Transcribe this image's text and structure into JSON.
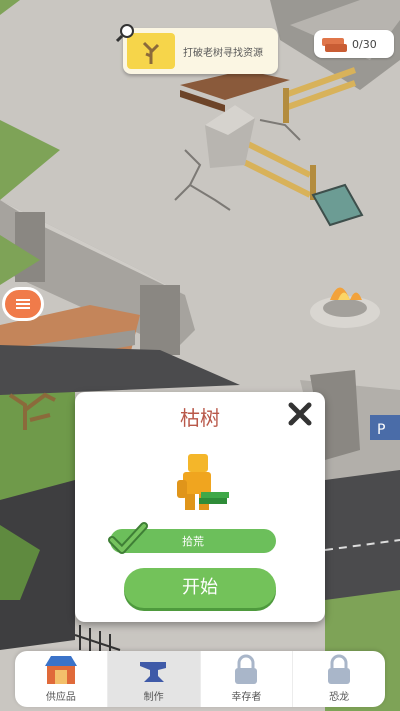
{
  "quest": {
    "text": "打破老树寻找资源",
    "icon": "dead-tree-icon"
  },
  "resource": {
    "count": "0/30",
    "icon": "brick-icon"
  },
  "dialog": {
    "title": "枯树",
    "task_label": "拾荒",
    "start_label": "开始"
  },
  "nav": {
    "items": [
      {
        "label": "供应品",
        "icon": "shop-icon",
        "locked": false
      },
      {
        "label": "制作",
        "icon": "anvil-icon",
        "locked": false
      },
      {
        "label": "幸存者",
        "icon": "lock-icon",
        "locked": true
      },
      {
        "label": "恐龙",
        "icon": "lock-icon",
        "locked": true
      }
    ]
  },
  "colors": {
    "accent_green": "#73c25a",
    "title_red": "#b9584a",
    "menu_orange": "#f07b4a"
  }
}
